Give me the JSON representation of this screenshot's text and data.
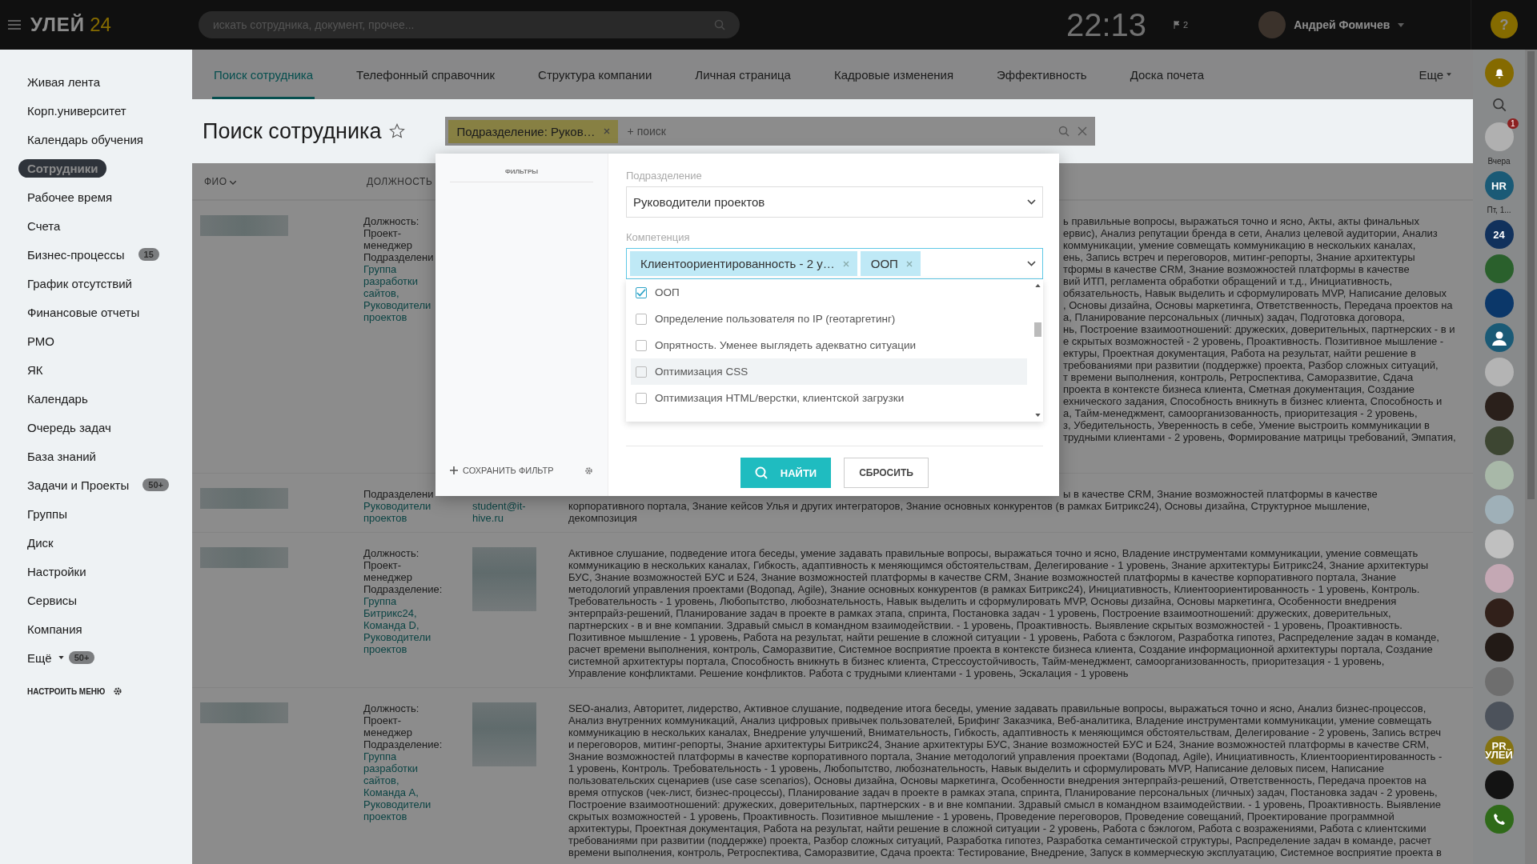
{
  "header": {
    "logo_word": "УЛЕЙ",
    "logo_number": "24",
    "search_placeholder": "искать сотрудника, документ, прочее...",
    "clock": "22:13",
    "flag_count": "2",
    "user_name": "Андрей Фомичев",
    "help": "?"
  },
  "sidebar": {
    "items": [
      {
        "label": "Живая лента",
        "selected": false
      },
      {
        "label": "Корп.университет",
        "selected": false
      },
      {
        "label": "Календарь обучения",
        "selected": false
      },
      {
        "label": "Сотрудники",
        "selected": true
      },
      {
        "label": "Рабочее время",
        "selected": false
      },
      {
        "label": "Счета",
        "selected": false
      },
      {
        "label": "Бизнес-процессы",
        "selected": false,
        "counter": "15"
      },
      {
        "label": "График отсутствий",
        "selected": false
      },
      {
        "label": "Финансовые отчеты",
        "selected": false
      },
      {
        "label": "РМО",
        "selected": false
      },
      {
        "label": "ЯК",
        "selected": false
      },
      {
        "label": "Календарь",
        "selected": false
      },
      {
        "label": "Очередь задач",
        "selected": false
      },
      {
        "label": "База знаний",
        "selected": false
      },
      {
        "label": "Задачи и Проекты",
        "selected": false,
        "counter": "50+"
      },
      {
        "label": "Группы",
        "selected": false
      },
      {
        "label": "Диск",
        "selected": false
      },
      {
        "label": "Настройки",
        "selected": false
      },
      {
        "label": "Сервисы",
        "selected": false
      },
      {
        "label": "Компания",
        "selected": false
      }
    ],
    "more": {
      "label": "Ещё",
      "counter": "50+"
    },
    "settings_label": "НАСТРОИТЬ МЕНЮ"
  },
  "tabs": [
    {
      "label": "Поиск сотрудника",
      "selected": true
    },
    {
      "label": "Телефонный справочник",
      "selected": false
    },
    {
      "label": "Структура компании",
      "selected": false
    },
    {
      "label": "Личная страница",
      "selected": false
    },
    {
      "label": "Кадровые изменения",
      "selected": false
    },
    {
      "label": "Эффективность",
      "selected": false
    },
    {
      "label": "Доска почета",
      "selected": false
    }
  ],
  "more_tab": "Еще",
  "page_title": "Поиск сотрудника",
  "filter": {
    "chip": "Подразделение: Руков…",
    "placeholder": "+ поиск"
  },
  "table": {
    "columns": [
      "ФИО",
      "ДОЛЖНОСТЬ"
    ],
    "rows": [
      {
        "position_label": "Должность:",
        "position": "Проект-менеджер",
        "department_label": "Подразделени",
        "departments": "Группа разработки сайтов, Руководители проектов",
        "partial_lines": [
          "ь правильные вопросы, выражаться точно и ясно, Акты, акты финальных",
          "ервис), Анализ репутации бренда в сети, Анализ целевой аудитории, Анализ",
          "коммуникации, умение совмещать коммуникацию в нескольких каналах,",
          "ень, Запись встреч и переговоров, митинг-репорты, Знание архитектуры",
          "тформы в качестве CRM, Знание возможностей платформы в качестве",
          "вий ИТП, регламента обработки обращений и т.д., Инициативность,",
          "обязательность, Навык выделить и сформулировать MVP, Написание деловых",
          ", Основы дизайна, Основы маркетинга, Ответственность, Передача проектов на",
          "а, Планирование персональных (личных) задач, Подготовка договора,",
          "нь, Построение взаимоотношений: дружеских, доверительных, партнерских - в и",
          "е скрытых возможностей - 2 уровень, Проактивность. Позитивное мышление -",
          "ектуры, Проектная документация, Работа на результат, найти решение в",
          "требованиями при развитии (поддержке) проекта, Разбор сложных ситуаций,",
          "т времени выполнения, контроль, Ретроспектива, Саморазвитие, Сдача",
          "проекта в контексте бизнеса клиента, Сметная документация, Создание",
          "ехнического задания, Способность вникнуть в бизнес клиента, Способность и",
          "а, Тайм-менеджмент, самоорганизованность, приоритезация - 2 уровень,",
          "з, Убедительность, Уверенность в себе, Умение выстроить коммуникации в",
          "трудными клиентами - 2 уровень, Формирование матрицы требований, Эмпатия,"
        ]
      },
      {
        "department_label": "Подразделени",
        "departments": "Руководители проектов",
        "email": "student@it-hive.ru",
        "partial_lines": [
          "ы в качестве CRM, Знание возможностей платформы в качестве"
        ],
        "competency_lines": [
          "корпоративного портала, Знание кейсов Улья и других интеграторов, Знание основных конкурентов (в рамках Битрикс24), Основы дизайна, Структурное мышление,",
          "декомпозиция"
        ]
      },
      {
        "position_label": "Должность:",
        "position": "Проект-менеджер",
        "department_label": "Подразделение:",
        "departments": "Группа Битрикс24, Команда D, Руководители проектов",
        "email_blurred": true,
        "competency_lines": [
          "Активное слушание, подведение итога беседы, умение задавать правильные вопросы, выражаться точно и ясно, Владение инструментами коммуникации, умение совмещать",
          "коммуникацию в нескольких каналах, Гибкость, адаптивность к меняющимся обстоятельствам, Делегирование - 1 уровень, Знание архитектуры Битрикс24, Знание архитектуры",
          "БУС, Знание возможностей БУС и Б24, Знание возможностей платформы в качестве CRM, Знание возможностей платформы в качестве корпоративного портала, Знание",
          "методологий управления проектами (Водопад, Agile), Знание основных конкурентов (в рамках Битрикс24), Инициативность, Клиентоориентированность - 1 уровень, Контроль.",
          "Требовательность - 1 уровень, Любопытство, любознательность, Навык выделить и сформулировать MVP, Основы дизайна, Основы маркетинга, Особенности внедрения",
          "энтерпрайз-решений, Планирование задач в проекте в рамках этапа, спринта, Постановка задач - 1 уровень, Построение взаимоотношений: дружеских, доверительных,",
          "партнерских - в и вне компании. Здравый смысл в командном взаимодействии. - 1 уровень, Проактивность. Выявление скрытых возможностей - 1 уровень, Проактивность.",
          "Позитивное мышление - 1 уровень, Работа на результат, найти решение в сложной ситуации - 1 уровень, Работа с бэклогом, Разработка гипотез, Распределение задач в команде,",
          "расчет времени выполнения, контроль, Саморазвитие, Системное восприятие проекта в контексте бизнеса клиента, Создание информационной архитектуры портала, Создание",
          "системной архитектуры портала, Способность вникнуть в бизнес клиента, Стрессоустойчивость, Тайм-менеджмент, самоорганизованность, приоритезация - 1 уровень,",
          "Управление конфликтами. Решение конфликтов. Работа с трудными клиентами - 1 уровень, Эскалация - 1 уровень"
        ]
      },
      {
        "position_label": "Должность:",
        "position": "Проект-менеджер",
        "department_label": "Подразделение:",
        "departments": "Группа разработки сайтов, Команда А, Руководители проектов",
        "email_blurred": true,
        "competency_lines": [
          "SEO-анализ, Авторитет, лидерство, Активное слушание, подведение итога беседы, умение задавать правильные вопросы, выражаться точно и ясно, Анализ бизнес-процессов,",
          "Анализ внутренних коммуникаций, Анализ цифровых привычек пользователей, Брифинг Заказчика, Веб-аналитика, Владение инструментами коммуникации, умение совмещать",
          "коммуникацию в нескольких каналах, Внедрение улучшений, Внимательность, Гибкость, адаптивность к меняющимся обстоятельствам, Делегирование - 2 уровень, Запись встреч",
          "и переговоров, митинг-репорты, Знание архитектуры Битрикс24, Знание архитектуры БУС, Знание возможностей БУС и Б24, Знание возможностей платформы в качестве CRM,",
          "Знание возможностей платформы в качестве корпоративного портала, Знание методологий управления проектами (Водопад, Agile), Инициативность, Клиентоориентированность -",
          "1 уровень, Контроль. Требовательность - 1 уровень, Любопытство, любознательность, Навык выделить и сформулировать MVP, Написание деловых писем, Написание",
          "пользовательских сценариев (use case scenarios), Основы дизайна, Основы маркетинга, Особенности внедрения энтерпрайз-решений, Ответственность, Передача проектов на",
          "время отпусков (чек-лист, бизнес-процессы), Планирование задач в проекте в рамках этапа, спринта, Планирование персональных (личных) задач, Постановка задач - 2 уровень,",
          "Построение взаимоотношений: дружеских, доверительных, партнерских - в и вне компании. Здравый смысл в командном взаимодействии. - 1 уровень, Проактивность. Выявление",
          "скрытых возможностей - 1 уровень, Проактивность. Позитивное мышление - 1 уровень, Проведение переговоров, Проведение совещаний, Проектирование программной",
          "архитектуры, Проектная документация, Работа на результат, найти решение в сложной ситуации - 2 уровень, Работа с бэклогом, Работа с возражениями, Работа с клиентскими",
          "требованиями при развитии (поддержке) проекта, Разбор сложных ситуаций, Разработка гипотез, Разработка семантической структуры, Распределение задач в команде, расчет",
          "времени выполнения, контроль, Ретроспектива, Саморазвитие, Сдача проекта: Тестирование, Внедрение, Запуск в коммерческую эксплуатацию, Системное восприятие проекта в"
        ]
      }
    ]
  },
  "modal": {
    "sidebar_title": "ФИЛЬТРЫ",
    "save_filter": "СОХРАНИТЬ ФИЛЬТР",
    "department": {
      "label": "Подразделение",
      "value": "Руководители проектов"
    },
    "competency": {
      "label": "Компетенция",
      "tags": [
        "Клиентоориентированность - 2 у…",
        "ООП"
      ],
      "options": [
        {
          "label": "ООП",
          "checked": true,
          "highlighted": false
        },
        {
          "label": "Определение пользователя по IP (геотаргетинг)",
          "checked": false,
          "highlighted": false
        },
        {
          "label": "Опрятность. Уменее выглядеть адекватно ситуации",
          "checked": false,
          "highlighted": false
        },
        {
          "label": "Оптимизация CSS",
          "checked": false,
          "highlighted": true
        },
        {
          "label": "Оптимизация HTML/верстки, клиентской загрузки",
          "checked": false,
          "highlighted": false
        }
      ]
    },
    "find_button": "НАЙТИ",
    "reset_button": "СБРОСИТЬ"
  },
  "right_panel": {
    "items": [
      {
        "kind": "bell",
        "color": "#856a00"
      },
      {
        "kind": "search"
      },
      {
        "kind": "avatar",
        "color": "#b0b0b0",
        "badge": "1"
      },
      {
        "kind": "date",
        "text": "Вчера"
      },
      {
        "kind": "avatar",
        "color": "#1a5a76",
        "text": "HR"
      },
      {
        "kind": "date",
        "text": "Пт, 1..."
      },
      {
        "kind": "avatar",
        "color": "#11315c",
        "text": "24"
      },
      {
        "kind": "avatar",
        "color": "#2a602c"
      },
      {
        "kind": "avatar",
        "color": "#0b3769"
      },
      {
        "kind": "person",
        "color": "#1a5a76"
      },
      {
        "kind": "avatar",
        "color": "#b4b4b4"
      },
      {
        "kind": "avatar",
        "color": "#2a201b"
      },
      {
        "kind": "avatar",
        "color": "#3d4632"
      },
      {
        "kind": "avatar",
        "color": "#a8b8a8"
      },
      {
        "kind": "avatar",
        "color": "#9fb0b8"
      },
      {
        "kind": "avatar",
        "color": "#c0c0c0"
      },
      {
        "kind": "avatar",
        "color": "#c4a8b4"
      },
      {
        "kind": "avatar",
        "color": "#31201a"
      },
      {
        "kind": "avatar",
        "color": "#221a16"
      },
      {
        "kind": "avatar",
        "color": "#6e6e6e"
      },
      {
        "kind": "avatar",
        "color": "#4c525b"
      },
      {
        "kind": "avatar",
        "color": "#857311",
        "text": "PR УЛЕЙ"
      },
      {
        "kind": "avatar",
        "color": "#131313"
      },
      {
        "kind": "phone",
        "color": "#2f6a19"
      }
    ]
  }
}
